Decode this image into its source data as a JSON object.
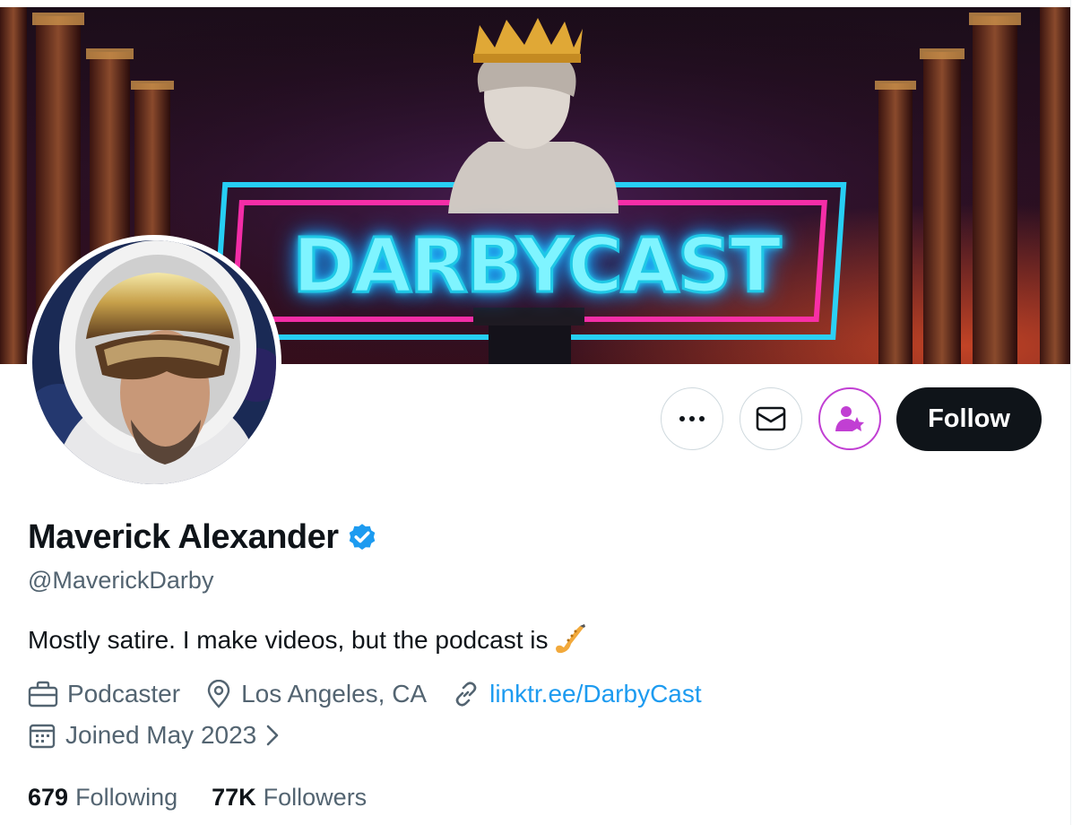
{
  "banner": {
    "title": "DARBYCAST",
    "colors": {
      "neon_cyan": "#26d9ff",
      "neon_pink": "#ff2fae",
      "gold": "#e0a836"
    }
  },
  "actions": {
    "more_icon": "more-icon",
    "message_icon": "envelope-icon",
    "subscribe_icon": "person-star-icon",
    "follow_label": "Follow"
  },
  "profile": {
    "name": "Maverick Alexander",
    "verified_icon": "verified-badge-icon",
    "handle": "@MaverickDarby",
    "bio": "Mostly satire. I make videos, but the podcast is",
    "bio_emoji_icon": "saxophone-icon",
    "profession": "Podcaster",
    "location": "Los Angeles, CA",
    "website": "linktr.ee/DarbyCast",
    "joined": "Joined May 2023",
    "colors": {
      "accent": "#1d9bf0",
      "text": "#0f1419",
      "muted": "#536471",
      "subscribe": "#c13fd3"
    }
  },
  "stats": {
    "following_count": "679",
    "following_label": "Following",
    "followers_count": "77K",
    "followers_label": "Followers"
  }
}
